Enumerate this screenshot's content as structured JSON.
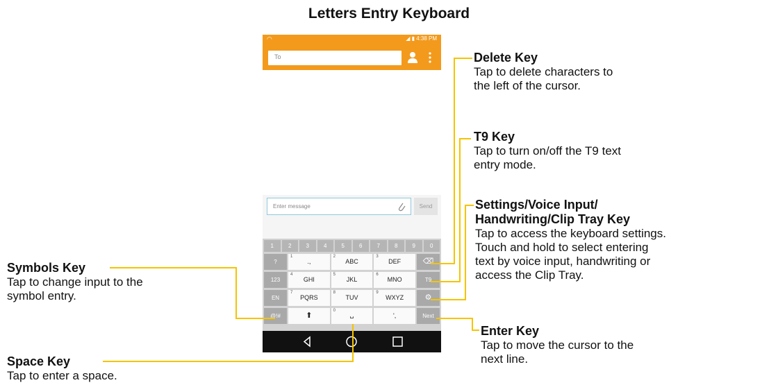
{
  "title": "Letters Entry Keyboard",
  "phone": {
    "status_time": "4:38 PM",
    "to_placeholder": "To",
    "message_placeholder": "Enter message",
    "send_label": "Send",
    "number_row": [
      "1",
      "2",
      "3",
      "4",
      "5",
      "6",
      "7",
      "8",
      "9",
      "0"
    ],
    "letter_rows": [
      [
        {
          "digit": "1",
          "letters": ".,"
        },
        {
          "digit": "2",
          "letters": "ABC"
        },
        {
          "digit": "3",
          "letters": "DEF"
        }
      ],
      [
        {
          "digit": "4",
          "letters": "GHI"
        },
        {
          "digit": "5",
          "letters": "JKL"
        },
        {
          "digit": "6",
          "letters": "MNO"
        }
      ],
      [
        {
          "digit": "7",
          "letters": "PQRS"
        },
        {
          "digit": "8",
          "letters": "TUV"
        },
        {
          "digit": "9",
          "letters": "WXYZ"
        }
      ],
      [
        {
          "digit": "",
          "letters": ""
        },
        {
          "digit": "0",
          "letters": ""
        },
        {
          "digit": "",
          "letters": "',"
        }
      ]
    ],
    "left_keys": [
      "?",
      "123",
      "EN",
      "@!#"
    ],
    "right_keys": [
      "",
      "T9",
      "",
      "Next"
    ]
  },
  "annotations": {
    "delete": {
      "title": "Delete Key",
      "desc": [
        "Tap to delete characters to",
        "the left of the cursor."
      ]
    },
    "t9": {
      "title": "T9 Key",
      "desc": [
        "Tap to turn on/off the T9 text",
        "entry mode."
      ]
    },
    "settings": {
      "title": [
        "Settings/Voice Input/",
        "Handwriting/Clip Tray Key"
      ],
      "desc": [
        "Tap to access the keyboard settings.",
        "Touch and hold to select entering",
        "text by voice input, handwriting or",
        "access the Clip Tray."
      ]
    },
    "enter": {
      "title": "Enter Key",
      "desc": [
        "Tap to move the cursor to the",
        "next line."
      ]
    },
    "symbols": {
      "title": "Symbols Key",
      "desc": [
        "Tap to change input to the",
        "symbol entry."
      ]
    },
    "space": {
      "title": "Space Key",
      "desc": [
        "Tap to enter a space."
      ]
    }
  },
  "colors": {
    "accent": "#f39a1c",
    "callout_line": "#f5c400"
  }
}
